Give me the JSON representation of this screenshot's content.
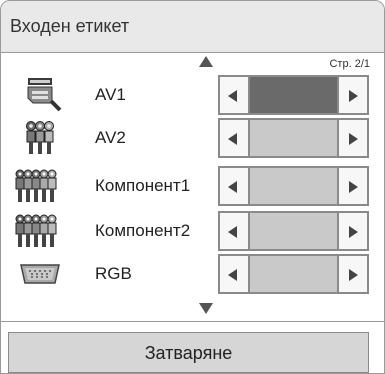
{
  "dialog": {
    "title": "Входен етикет",
    "page_indicator": "Стр. 2/1",
    "close_label": "Затваряне"
  },
  "rows": [
    {
      "label": "AV1",
      "icon": "scart-connector-icon",
      "selected": true
    },
    {
      "label": "AV2",
      "icon": "rca-connector-icon",
      "selected": false
    },
    {
      "label": "Компонент1",
      "icon": "component-connector-icon",
      "selected": false
    },
    {
      "label": "Компонент2",
      "icon": "component-connector-icon",
      "selected": false
    },
    {
      "label": "RGB",
      "icon": "vga-connector-icon",
      "selected": false
    }
  ],
  "colors": {
    "selected_value": "#6a6a6a",
    "value_bg": "#c9c9c9",
    "title_bg": "#e9e9e9"
  }
}
